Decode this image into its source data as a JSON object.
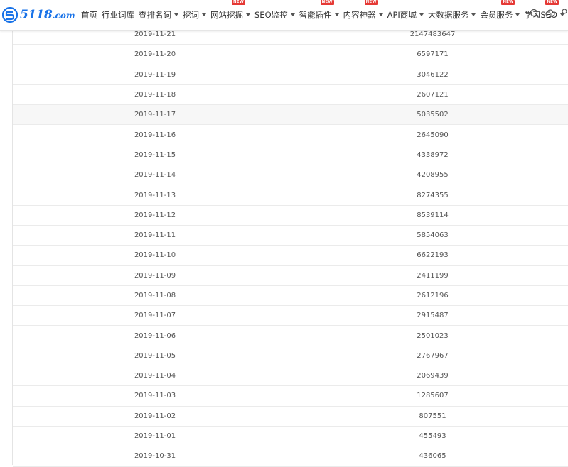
{
  "brand": {
    "name": "5118",
    "domain": ".com",
    "color": "#1a73e8"
  },
  "nav": {
    "items": [
      {
        "label": "首页",
        "dropdown": false,
        "badge": ""
      },
      {
        "label": "行业词库",
        "dropdown": false,
        "badge": ""
      },
      {
        "label": "查排名词",
        "dropdown": true,
        "badge": ""
      },
      {
        "label": "挖词",
        "dropdown": true,
        "badge": ""
      },
      {
        "label": "网站挖掘",
        "dropdown": true,
        "badge": "NEW"
      },
      {
        "label": "SEO监控",
        "dropdown": true,
        "badge": ""
      },
      {
        "label": "智能插件",
        "dropdown": true,
        "badge": "NEW"
      },
      {
        "label": "内容神器",
        "dropdown": true,
        "badge": "NEW"
      },
      {
        "label": "API商城",
        "dropdown": true,
        "badge": ""
      },
      {
        "label": "大数据服务",
        "dropdown": true,
        "badge": ""
      },
      {
        "label": "会员服务",
        "dropdown": true,
        "badge": "NEW"
      },
      {
        "label": "学习SEO",
        "dropdown": true,
        "badge": "NEW"
      }
    ],
    "badge_color": "#e53935",
    "icons": [
      "search-icon",
      "cloud-download-icon",
      "user-icon"
    ]
  },
  "table": {
    "rows": [
      {
        "date": "2019-11-21",
        "value": "2147483647"
      },
      {
        "date": "2019-11-20",
        "value": "6597171"
      },
      {
        "date": "2019-11-19",
        "value": "3046122"
      },
      {
        "date": "2019-11-18",
        "value": "2607121"
      },
      {
        "date": "2019-11-17",
        "value": "5035502",
        "highlighted": true
      },
      {
        "date": "2019-11-16",
        "value": "2645090"
      },
      {
        "date": "2019-11-15",
        "value": "4338972"
      },
      {
        "date": "2019-11-14",
        "value": "4208955"
      },
      {
        "date": "2019-11-13",
        "value": "8274355"
      },
      {
        "date": "2019-11-12",
        "value": "8539114"
      },
      {
        "date": "2019-11-11",
        "value": "5854063"
      },
      {
        "date": "2019-11-10",
        "value": "6622193"
      },
      {
        "date": "2019-11-09",
        "value": "2411199"
      },
      {
        "date": "2019-11-08",
        "value": "2612196"
      },
      {
        "date": "2019-11-07",
        "value": "2915487"
      },
      {
        "date": "2019-11-06",
        "value": "2501023"
      },
      {
        "date": "2019-11-05",
        "value": "2767967"
      },
      {
        "date": "2019-11-04",
        "value": "2069439"
      },
      {
        "date": "2019-11-03",
        "value": "1285607"
      },
      {
        "date": "2019-11-02",
        "value": "807551"
      },
      {
        "date": "2019-11-01",
        "value": "455493"
      },
      {
        "date": "2019-10-31",
        "value": "436065"
      }
    ]
  }
}
